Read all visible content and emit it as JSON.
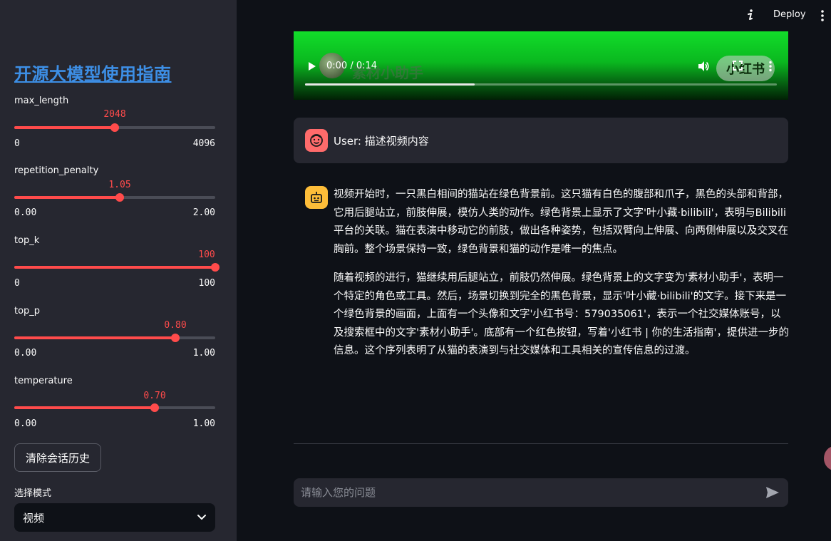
{
  "sidebar": {
    "title": "开源大模型使用指南",
    "sliders": [
      {
        "label": "max_length",
        "value": "2048",
        "min": "0",
        "max": "4096",
        "fraction": 0.5
      },
      {
        "label": "repetition_penalty",
        "value": "1.05",
        "min": "0.00",
        "max": "2.00",
        "fraction": 0.525
      },
      {
        "label": "top_k",
        "value": "100",
        "min": "0",
        "max": "100",
        "fraction": 1.0
      },
      {
        "label": "top_p",
        "value": "0.80",
        "min": "0.00",
        "max": "1.00",
        "fraction": 0.8
      },
      {
        "label": "temperature",
        "value": "0.70",
        "min": "0.00",
        "max": "1.00",
        "fraction": 0.7
      }
    ],
    "clear_button": "清除会话历史",
    "mode_label": "选择模式",
    "mode_value": "视频"
  },
  "header": {
    "deploy": "Deploy",
    "icons": [
      "info-icon",
      "more-vertical-icon"
    ]
  },
  "video": {
    "time": "0:00 / 0:14",
    "progress": 0.36,
    "watermark": "素材小助手",
    "logo": "小红书",
    "icons": [
      "play-icon",
      "volume-icon",
      "fullscreen-icon",
      "more-vertical-icon"
    ]
  },
  "messages": {
    "user": "User: 描述视频内容",
    "assistant_paragraphs": [
      "视频开始时，一只黑白相间的猫站在绿色背景前。这只猫有白色的腹部和爪子，黑色的头部和背部，它用后腿站立，前肢伸展，模仿人类的动作。绿色背景上显示了文字'叶小藏·bilibili'，表明与Bilibili平台的关联。猫在表演中移动它的前肢，做出各种姿势，包括双臂向上伸展、向两侧伸展以及交叉在胸前。整个场景保持一致，绿色背景和猫的动作是唯一的焦点。",
      "随着视频的进行，猫继续用后腿站立，前肢仍然伸展。绿色背景上的文字变为'素材小助手'，表明一个特定的角色或工具。然后，场景切换到完全的黑色背景，显示'叶小藏·bilibili'的文字。接下来是一个绿色背景的画面，上面有一个头像和文字'小红书号：579035061'，表示一个社交媒体账号，以及搜索框中的文字'素材小助手'。底部有一个红色按钮，写着'小红书 | 你的生活指南'，提供进一步的信息。这个序列表明了从猫的表演到与社交媒体和工具相关的宣传信息的过渡。"
    ]
  },
  "chat_input": {
    "placeholder": "请输入您的问题"
  },
  "colors": {
    "accent": "#ff4b4b",
    "sidebar_bg": "#262730",
    "main_bg": "#0e1117",
    "title_link": "#3d8fe6",
    "user_avatar": "#ff6b6b",
    "bot_avatar": "#fdbd39"
  }
}
